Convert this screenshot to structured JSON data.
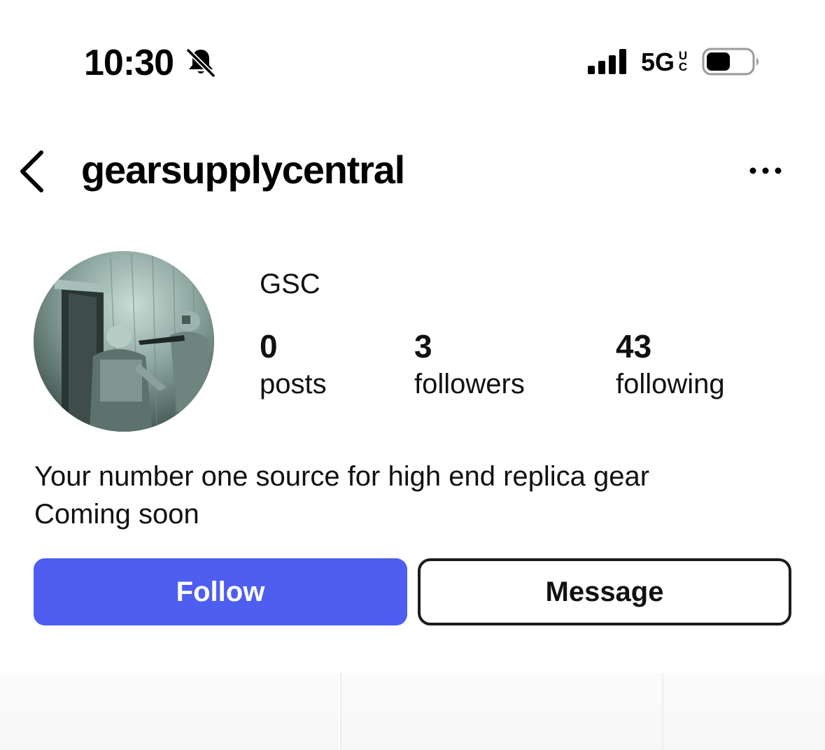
{
  "status_bar": {
    "time": "10:30",
    "network": "5G",
    "network_sub": "UC",
    "icons": [
      "bell-slash-icon",
      "signal-icon",
      "battery-icon"
    ]
  },
  "header": {
    "username": "gearsupplycentral",
    "back_icon": "chevron-left-icon",
    "more_icon": "ellipsis-icon"
  },
  "profile": {
    "display_name": "GSC",
    "stats": [
      {
        "value": "0",
        "label": "posts"
      },
      {
        "value": "3",
        "label": "followers"
      },
      {
        "value": "43",
        "label": "following"
      }
    ],
    "bio_lines": [
      "Your number one source for high end replica gear",
      "Coming soon"
    ]
  },
  "actions": {
    "follow_label": "Follow",
    "message_label": "Message"
  },
  "colors": {
    "follow_button": "#4e5ef0",
    "text": "#111111",
    "background": "#ffffff"
  }
}
